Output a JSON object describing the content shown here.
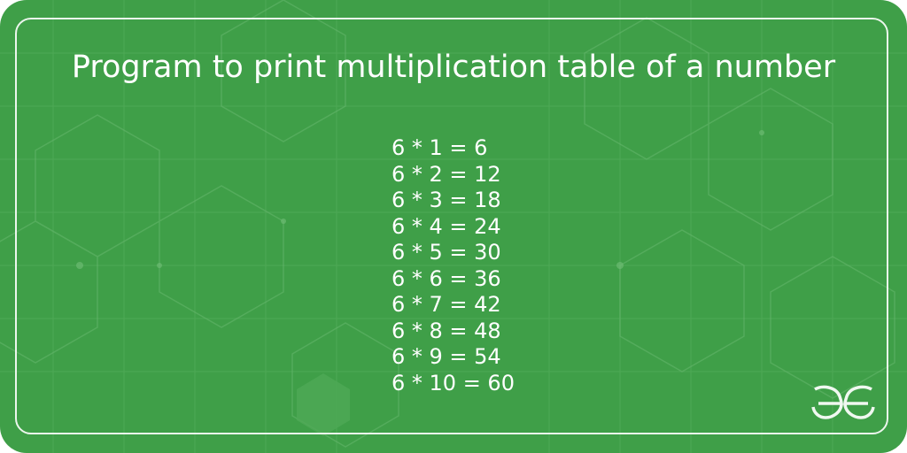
{
  "title": "Program to print multiplication table of a number",
  "table_lines": [
    "6 * 1 = 6",
    "6 * 2 = 12",
    "6 * 3 = 18",
    "6 * 4 = 24",
    "6 * 5 = 30",
    "6 * 6 = 36",
    "6 * 7 = 42",
    "6 * 8 = 48",
    "6 * 9 = 54",
    "6 * 10 = 60"
  ],
  "colors": {
    "background": "#3f9f48",
    "text": "#ffffff",
    "pattern": "#5bb062"
  },
  "logo": {
    "icon": "geeksforgeeks-logo-icon"
  }
}
